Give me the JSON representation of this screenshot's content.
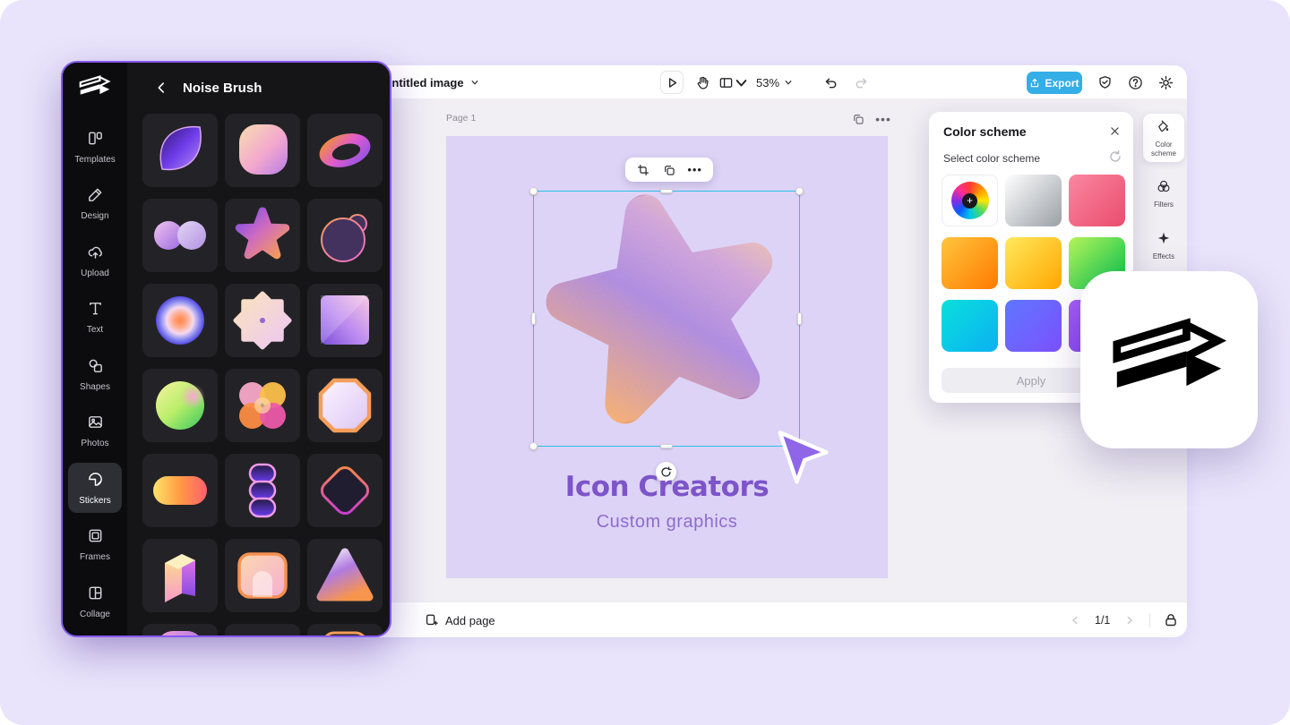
{
  "colors": {
    "accent_purple": "#8659f2",
    "export_blue": "#34aee6",
    "selection_cyan": "#2ac1e8",
    "canvas_lavender": "#ddd3f6",
    "headline_purple": "#7d54c9",
    "panel_dark": "#151518"
  },
  "topbar": {
    "document_title": "Untitled image",
    "zoom_level": "53%",
    "export_label": "Export"
  },
  "left_panel": {
    "title": "Noise Brush",
    "nav": [
      {
        "label": "Templates",
        "icon": "templates-icon"
      },
      {
        "label": "Design",
        "icon": "design-icon"
      },
      {
        "label": "Upload",
        "icon": "upload-icon"
      },
      {
        "label": "Text",
        "icon": "text-icon"
      },
      {
        "label": "Shapes",
        "icon": "shapes-icon"
      },
      {
        "label": "Photos",
        "icon": "photos-icon"
      },
      {
        "label": "Stickers",
        "icon": "stickers-icon",
        "active": true
      },
      {
        "label": "Frames",
        "icon": "frames-icon"
      },
      {
        "label": "Collage",
        "icon": "collage-icon"
      }
    ],
    "stickers": [
      {
        "name": "purple-leaf",
        "shape": "leaf"
      },
      {
        "name": "peach-squircle",
        "shape": "squircle"
      },
      {
        "name": "gradient-ring",
        "shape": "ring"
      },
      {
        "name": "twin-circles",
        "shape": "twins"
      },
      {
        "name": "gradient-star",
        "shape": "star"
      },
      {
        "name": "outlined-blob",
        "shape": "blob"
      },
      {
        "name": "radial-glow-circle",
        "shape": "radial"
      },
      {
        "name": "flower-burst",
        "shape": "flower8"
      },
      {
        "name": "fold-square",
        "shape": "fold"
      },
      {
        "name": "lime-circle",
        "shape": "lime"
      },
      {
        "name": "clover",
        "shape": "clover"
      },
      {
        "name": "octagon-badge",
        "shape": "octagon"
      },
      {
        "name": "sunset-pill",
        "shape": "pill"
      },
      {
        "name": "wavy-stack",
        "shape": "wavy"
      },
      {
        "name": "diamond-outline",
        "shape": "diamond"
      },
      {
        "name": "prism",
        "shape": "prism"
      },
      {
        "name": "arch-stamp",
        "shape": "arch"
      },
      {
        "name": "gradient-triangle",
        "shape": "triangle"
      },
      {
        "name": "partial-row-a",
        "shape": "p1"
      },
      {
        "name": "partial-row-b",
        "shape": "p2"
      },
      {
        "name": "partial-row-c",
        "shape": "p3"
      }
    ]
  },
  "workspace": {
    "page_label": "Page 1"
  },
  "canvas_text": {
    "headline": "Icon Creators",
    "subheadline": "Custom graphics"
  },
  "color_panel": {
    "title": "Color scheme",
    "subtitle": "Select color scheme",
    "apply_label": "Apply",
    "swatches": [
      {
        "name": "color-wheel",
        "type": "wheel"
      },
      {
        "name": "white-gray",
        "colors": [
          "#ffffff",
          "#9aa0a6"
        ]
      },
      {
        "name": "pink-red",
        "colors": [
          "#fa87a0",
          "#ea4c6e"
        ]
      },
      {
        "name": "orange",
        "colors": [
          "#ffc53d",
          "#ff7a00"
        ]
      },
      {
        "name": "yellow-amber",
        "colors": [
          "#ffe95c",
          "#ffa600"
        ]
      },
      {
        "name": "green",
        "colors": [
          "#b7f25a",
          "#00c24e"
        ]
      },
      {
        "name": "cyan-blue",
        "colors": [
          "#0ae0dc",
          "#0bb0f2"
        ]
      },
      {
        "name": "blue-violet",
        "colors": [
          "#5f76ff",
          "#7d52ff"
        ]
      },
      {
        "name": "purple",
        "colors": [
          "#a55ef7",
          "#7a3cf0"
        ]
      }
    ]
  },
  "right_rail": {
    "items": [
      {
        "label": "Color scheme",
        "icon": "fill-bucket-icon",
        "active": true
      },
      {
        "label": "Filters",
        "icon": "filters-icon"
      },
      {
        "label": "Effects",
        "icon": "effects-icon"
      }
    ]
  },
  "bottom_bar": {
    "add_page_label": "Add page",
    "page_indicator": "1/1"
  }
}
